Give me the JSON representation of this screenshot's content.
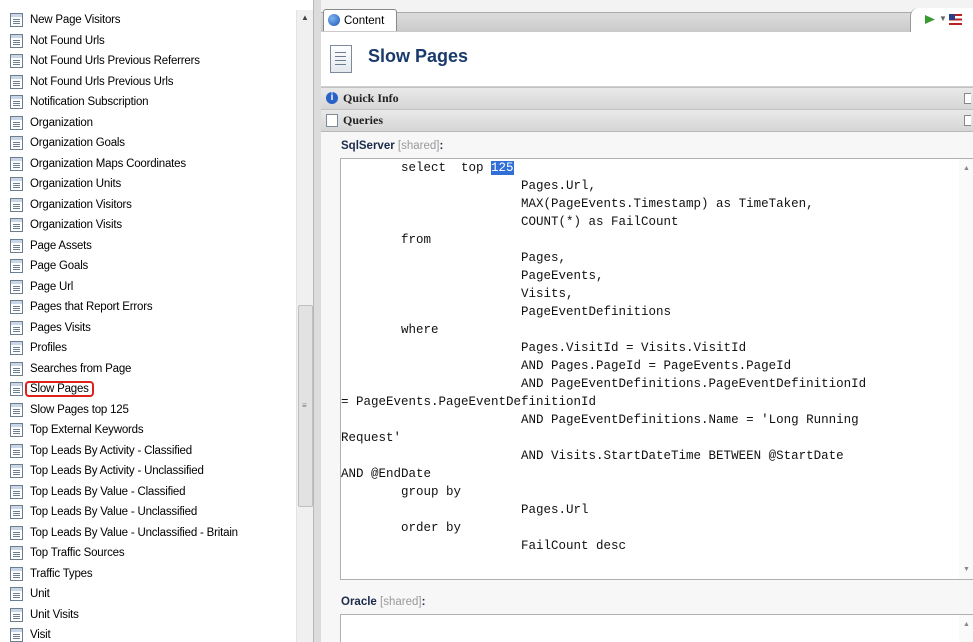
{
  "tree": {
    "items": [
      {
        "label": "New Page Visitors"
      },
      {
        "label": "Not Found Urls"
      },
      {
        "label": "Not Found Urls Previous Referrers"
      },
      {
        "label": "Not Found Urls Previous Urls"
      },
      {
        "label": "Notification Subscription"
      },
      {
        "label": "Organization"
      },
      {
        "label": "Organization Goals"
      },
      {
        "label": "Organization Maps Coordinates"
      },
      {
        "label": "Organization Units"
      },
      {
        "label": "Organization Visitors"
      },
      {
        "label": "Organization Visits"
      },
      {
        "label": "Page Assets"
      },
      {
        "label": "Page Goals"
      },
      {
        "label": "Page Url"
      },
      {
        "label": "Pages that Report Errors"
      },
      {
        "label": "Pages Visits"
      },
      {
        "label": "Profiles"
      },
      {
        "label": "Searches from Page"
      },
      {
        "label": "Slow Pages",
        "selected": true
      },
      {
        "label": "Slow Pages top 125"
      },
      {
        "label": "Top External Keywords"
      },
      {
        "label": "Top Leads By Activity - Classified"
      },
      {
        "label": "Top Leads By Activity - Unclassified"
      },
      {
        "label": "Top Leads By Value - Classified"
      },
      {
        "label": "Top Leads By Value - Unclassified"
      },
      {
        "label": "Top Leads By Value - Unclassified - Britain"
      },
      {
        "label": "Top Traffic Sources"
      },
      {
        "label": "Traffic Types"
      },
      {
        "label": "Unit"
      },
      {
        "label": "Unit Visits"
      },
      {
        "label": "Visit"
      }
    ]
  },
  "tab": {
    "label": "Content"
  },
  "header": {
    "title": "Slow Pages"
  },
  "sections": {
    "quick_info": "Quick Info",
    "queries": "Queries"
  },
  "sql": {
    "label": "SqlServer",
    "shared": "[shared]",
    "colon": ":",
    "code_before": "        select  top ",
    "code_highlight": "125",
    "code_after": "\n                        Pages.Url,\n                        MAX(PageEvents.Timestamp) as TimeTaken,\n                        COUNT(*) as FailCount\n        from\n                        Pages,\n                        PageEvents,\n                        Visits,\n                        PageEventDefinitions\n        where\n                        Pages.VisitId = Visits.VisitId\n                        AND Pages.PageId = PageEvents.PageId\n                        AND PageEventDefinitions.PageEventDefinitionId\n= PageEvents.PageEventDefinitionId\n                        AND PageEventDefinitions.Name = 'Long Running\nRequest'\n                        AND Visits.StartDateTime BETWEEN @StartDate\nAND @EndDate\n        group by\n                        Pages.Url\n        order by\n                        FailCount desc"
  },
  "oracle": {
    "label": "Oracle",
    "shared": "[shared]",
    "colon": ":"
  }
}
